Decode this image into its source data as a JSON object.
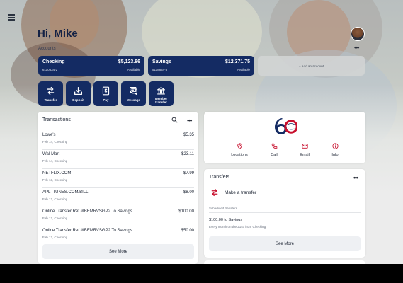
{
  "header": {
    "greeting": "Hi, Mike",
    "accounts_label": "Accounts"
  },
  "accounts": [
    {
      "name": "Checking",
      "number": "6110834-2",
      "balance": "$5,123.86",
      "balance_label": "Available"
    },
    {
      "name": "Savings",
      "number": "5118834-3",
      "balance": "$12,371.75",
      "balance_label": "Available"
    }
  ],
  "add_account_label": "+ Add an account",
  "actions": [
    {
      "label": "Transfer",
      "icon": "transfer-icon"
    },
    {
      "label": "Deposit",
      "icon": "deposit-icon"
    },
    {
      "label": "Pay",
      "icon": "pay-icon"
    },
    {
      "label": "Message",
      "icon": "message-icon"
    },
    {
      "label": "Member transfer",
      "icon": "bank-icon"
    }
  ],
  "transactions": {
    "title": "Transactions",
    "items": [
      {
        "description": "Lowe's",
        "sub": "Feb 14, Checking",
        "amount": "$5.35"
      },
      {
        "description": "Wal-Mart",
        "sub": "Feb 14, Checking",
        "amount": "$23.11"
      },
      {
        "description": "NETFLIX.COM",
        "sub": "Feb 13, Checking",
        "amount": "$7.99"
      },
      {
        "description": "APL ITUNES.COM/BILL",
        "sub": "Feb 12, Checking",
        "amount": "$8.00"
      },
      {
        "description": "Online Transfer Ref #IBEMRVSGP2 To Savings",
        "sub": "Feb 12, Checking",
        "amount": "$100.00"
      },
      {
        "description": "Online Transfer Ref #IBEMRVSGP2 To Savings",
        "sub": "Feb 12, Checking",
        "amount": "$50.00"
      }
    ],
    "see_more": "See More"
  },
  "bank": {
    "quick_links": [
      {
        "label": "Locations",
        "icon": "location-pin-icon"
      },
      {
        "label": "Call",
        "icon": "phone-icon"
      },
      {
        "label": "Email",
        "icon": "email-icon"
      },
      {
        "label": "Info",
        "icon": "info-icon"
      }
    ],
    "brand_color": "#c8102e",
    "logo_color": "#142b63"
  },
  "transfers": {
    "title": "Transfers",
    "make_transfer": "Make a transfer",
    "scheduled_label": "Scheduled transfers",
    "scheduled_main": "$100.00 to Savings",
    "scheduled_sub": "Every month on the 21st, from Checking",
    "see_more": "See More"
  },
  "colors": {
    "primary": "#142b63",
    "accent_red": "#c8102e"
  }
}
